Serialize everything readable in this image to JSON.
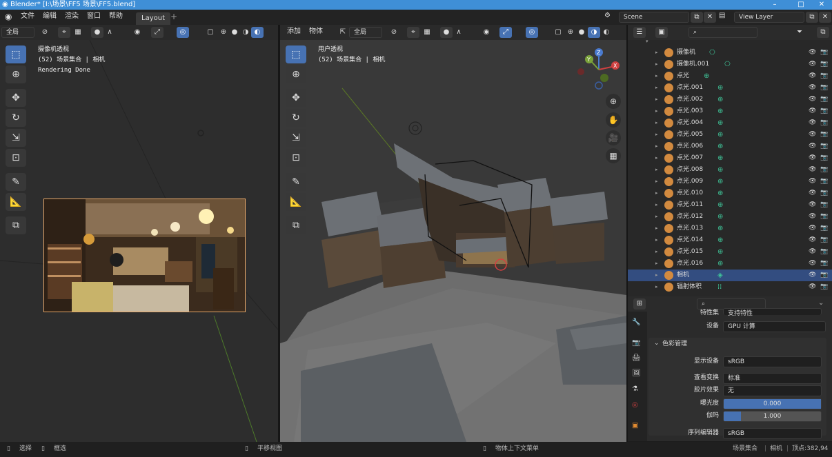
{
  "window": {
    "title": "Blender* [I:\\场景\\FF5 场景\\FF5.blend]",
    "minimize": "–",
    "maximize": "□",
    "close": "✕"
  },
  "topbar": {
    "menus": [
      "文件",
      "编辑",
      "渲染",
      "窗口",
      "帮助"
    ],
    "workspace_tab": "Layout",
    "add_tab": "+",
    "scene": "Scene",
    "view_layer": "View Layer"
  },
  "left_view": {
    "header_mode": "全局",
    "title": "摄像机透视",
    "subtitle": "(52) 场景集合 | 相机",
    "status": "Rendering Done"
  },
  "center_view": {
    "header_menus": [
      "添加",
      "物体"
    ],
    "header_mode": "全局",
    "title": "用户透视",
    "subtitle": "(52) 场景集合 | 相机",
    "gizmo": {
      "z": "Z",
      "y": "Y",
      "x": "X"
    }
  },
  "outliner": {
    "items": [
      {
        "name": "摄像机",
        "type": "camera"
      },
      {
        "name": "摄像机.001",
        "type": "camera"
      },
      {
        "name": "点光",
        "type": "light"
      },
      {
        "name": "点光.001",
        "type": "light"
      },
      {
        "name": "点光.002",
        "type": "light"
      },
      {
        "name": "点光.003",
        "type": "light"
      },
      {
        "name": "点光.004",
        "type": "light"
      },
      {
        "name": "点光.005",
        "type": "light"
      },
      {
        "name": "点光.006",
        "type": "light"
      },
      {
        "name": "点光.007",
        "type": "light"
      },
      {
        "name": "点光.008",
        "type": "light"
      },
      {
        "name": "点光.009",
        "type": "light"
      },
      {
        "name": "点光.010",
        "type": "light"
      },
      {
        "name": "点光.011",
        "type": "light"
      },
      {
        "name": "点光.012",
        "type": "light"
      },
      {
        "name": "点光.013",
        "type": "light"
      },
      {
        "name": "点光.014",
        "type": "light"
      },
      {
        "name": "点光.015",
        "type": "light"
      },
      {
        "name": "点光.016",
        "type": "light"
      },
      {
        "name": "相机",
        "type": "mesh",
        "selected": true
      },
      {
        "name": "辐射体积",
        "type": "volume"
      }
    ]
  },
  "properties": {
    "partial_label": "特性集",
    "partial_value": "支持特性",
    "device_label": "设备",
    "device_value": "GPU 计算",
    "section": "色彩管理",
    "display_device_label": "显示设备",
    "display_device_value": "sRGB",
    "view_transform_label": "查看变换",
    "view_transform_value": "标准",
    "look_label": "胶片效果",
    "look_value": "无",
    "exposure_label": "曝光度",
    "exposure_value": "0.000",
    "exposure_fill": 1.0,
    "gamma_label": "伽玛",
    "gamma_value": "1.000",
    "gamma_fill": 0.18,
    "sequencer_label": "序列编辑器",
    "sequencer_value": "sRGB"
  },
  "statusbar": {
    "select": "选择",
    "box_select": "框选",
    "pan_view": "平移视图",
    "context_menu": "物体上下文菜单",
    "scene_collection": "场景集合",
    "object": "相机",
    "vertices": "顶点:382,94"
  },
  "colors": {
    "accent": "#4772b3",
    "title_bar": "#3f8fd7",
    "light_icon": "#d28a3f",
    "data_icon": "#3fc79a"
  }
}
